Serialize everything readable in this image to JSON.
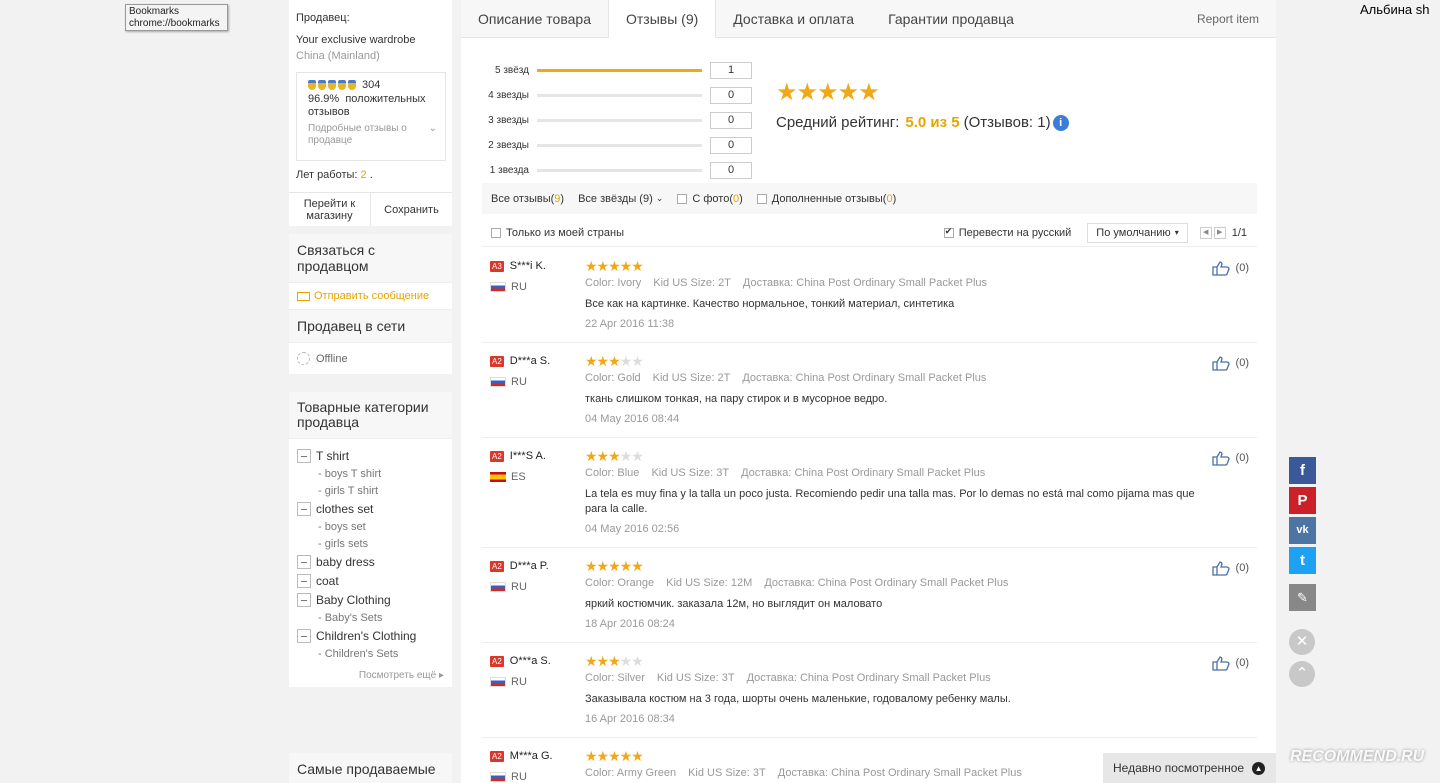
{
  "tooltip": {
    "line1": "Bookmarks",
    "line2": "chrome://bookmarks"
  },
  "user": {
    "name": "Альбина sh"
  },
  "seller": {
    "label": "Продавец:",
    "name": "Your exclusive wardrobe",
    "country": "China (Mainland)",
    "medal_count": "304",
    "positive_pct": "96.9%",
    "positive_label": "положительных отзывов",
    "detail_link": "Подробные отзывы о продавце",
    "years_label": "Лет работы:",
    "years_value": "2",
    "years_suffix": ".",
    "go_store": "Перейти к магазину",
    "save": "Сохранить"
  },
  "contact": {
    "title": "Связаться с продавцом",
    "send_message": "Отправить сообщение",
    "online_title": "Продавец в сети",
    "status": "Offline"
  },
  "categories": {
    "title": "Товарные категории продавца",
    "items": [
      {
        "label": "T shirt",
        "subs": [
          "- boys T shirt",
          "- girls T shirt"
        ]
      },
      {
        "label": "clothes set",
        "subs": [
          "- boys set",
          "- girls sets"
        ]
      },
      {
        "label": "baby dress",
        "subs": []
      },
      {
        "label": "coat",
        "subs": []
      },
      {
        "label": "Baby Clothing",
        "subs": [
          "- Baby's Sets"
        ]
      },
      {
        "label": "Children's Clothing",
        "subs": [
          "- Children's Sets"
        ]
      }
    ],
    "more": "Посмотреть ещё"
  },
  "bestsellers": {
    "title": "Самые продаваемые"
  },
  "tabs": [
    {
      "label": "Описание товара"
    },
    {
      "label": "Отзывы (9)"
    },
    {
      "label": "Доставка и оплата"
    },
    {
      "label": "Гарантии продавца"
    }
  ],
  "report": "Report item",
  "distribution": [
    {
      "label": "5 звёзд",
      "count": "1",
      "fill": 1.0
    },
    {
      "label": "4 звезды",
      "count": "0",
      "fill": 0
    },
    {
      "label": "3 звезды",
      "count": "0",
      "fill": 0
    },
    {
      "label": "2 звезды",
      "count": "0",
      "fill": 0
    },
    {
      "label": "1 звезда",
      "count": "0",
      "fill": 0
    }
  ],
  "average": {
    "stars": "★★★★★",
    "label": "Средний рейтинг:",
    "value": "5.0 из 5",
    "count_text": "(Отзывов: 1)",
    "info": "i"
  },
  "filters": {
    "all_reviews": "Все отзывы",
    "all_count": "9",
    "all_stars": "Все звёзды (9)",
    "with_photo": "С фото",
    "photo_count": "0",
    "additional": "Дополненные отзывы",
    "additional_count": "0",
    "my_country": "Только из моей страны",
    "translate": "Перевести на русский",
    "sort": "По умолчанию",
    "page": "1/1"
  },
  "reviews": [
    {
      "level": "A3",
      "name": "S***i K.",
      "country": "RU",
      "flag": "ru",
      "rating": 5,
      "color": "Ivory",
      "size": "2T",
      "shipping": "China Post Ordinary Small Packet Plus",
      "text": "Все как на картинке. Качество нормальное, тонкий материал, синтетика",
      "date": "22 Apr 2016 11:38",
      "likes": "(0)"
    },
    {
      "level": "A2",
      "name": "D***a S.",
      "country": "RU",
      "flag": "ru",
      "rating": 3,
      "color": "Gold",
      "size": "2T",
      "shipping": "China Post Ordinary Small Packet Plus",
      "text": "ткань слишком тонкая, на пару стирок и в мусорное ведро.",
      "date": "04 May 2016 08:44",
      "likes": "(0)"
    },
    {
      "level": "A2",
      "name": "I***S A.",
      "country": "ES",
      "flag": "es",
      "rating": 3,
      "color": "Blue",
      "size": "3T",
      "shipping": "China Post Ordinary Small Packet Plus",
      "text": "La tela es muy fina y la talla un poco justa. Recomiendo pedir una talla mas. Por lo demas no está mal como pijama mas que para la calle.",
      "date": "04 May 2016 02:56",
      "likes": "(0)"
    },
    {
      "level": "A2",
      "name": "D***a P.",
      "country": "RU",
      "flag": "ru",
      "rating": 5,
      "color": "Orange",
      "size": "12M",
      "shipping": "China Post Ordinary Small Packet Plus",
      "text": "яркий костюмчик. заказала 12м, но выглядит он маловато",
      "date": "18 Apr 2016 08:24",
      "likes": "(0)"
    },
    {
      "level": "A2",
      "name": "O***a S.",
      "country": "RU",
      "flag": "ru",
      "rating": 3,
      "color": "Silver",
      "size": "3T",
      "shipping": "China Post Ordinary Small Packet Plus",
      "text": "Заказывала костюм на 3 года, шорты очень маленькие, годовалому ребенку малы.",
      "date": "16 Apr 2016 08:34",
      "likes": "(0)"
    },
    {
      "level": "A2",
      "name": "M***a G.",
      "country": "RU",
      "flag": "ru",
      "rating": 5,
      "color": "Army Green",
      "size": "3T",
      "shipping": "China Post Ordinary Small Packet Plus",
      "text": "",
      "date": "",
      "likes": ""
    }
  ],
  "review_labels": {
    "color": "Color:",
    "size": "Kid US Size:",
    "shipping": "Доставка:"
  },
  "social": {
    "fb": "f",
    "pin": "P",
    "vk": "vk",
    "tw": "t",
    "pen": "✎"
  },
  "recent": {
    "label": "Недавно посмотренное"
  },
  "watermark": "RECOMMEND.RU"
}
